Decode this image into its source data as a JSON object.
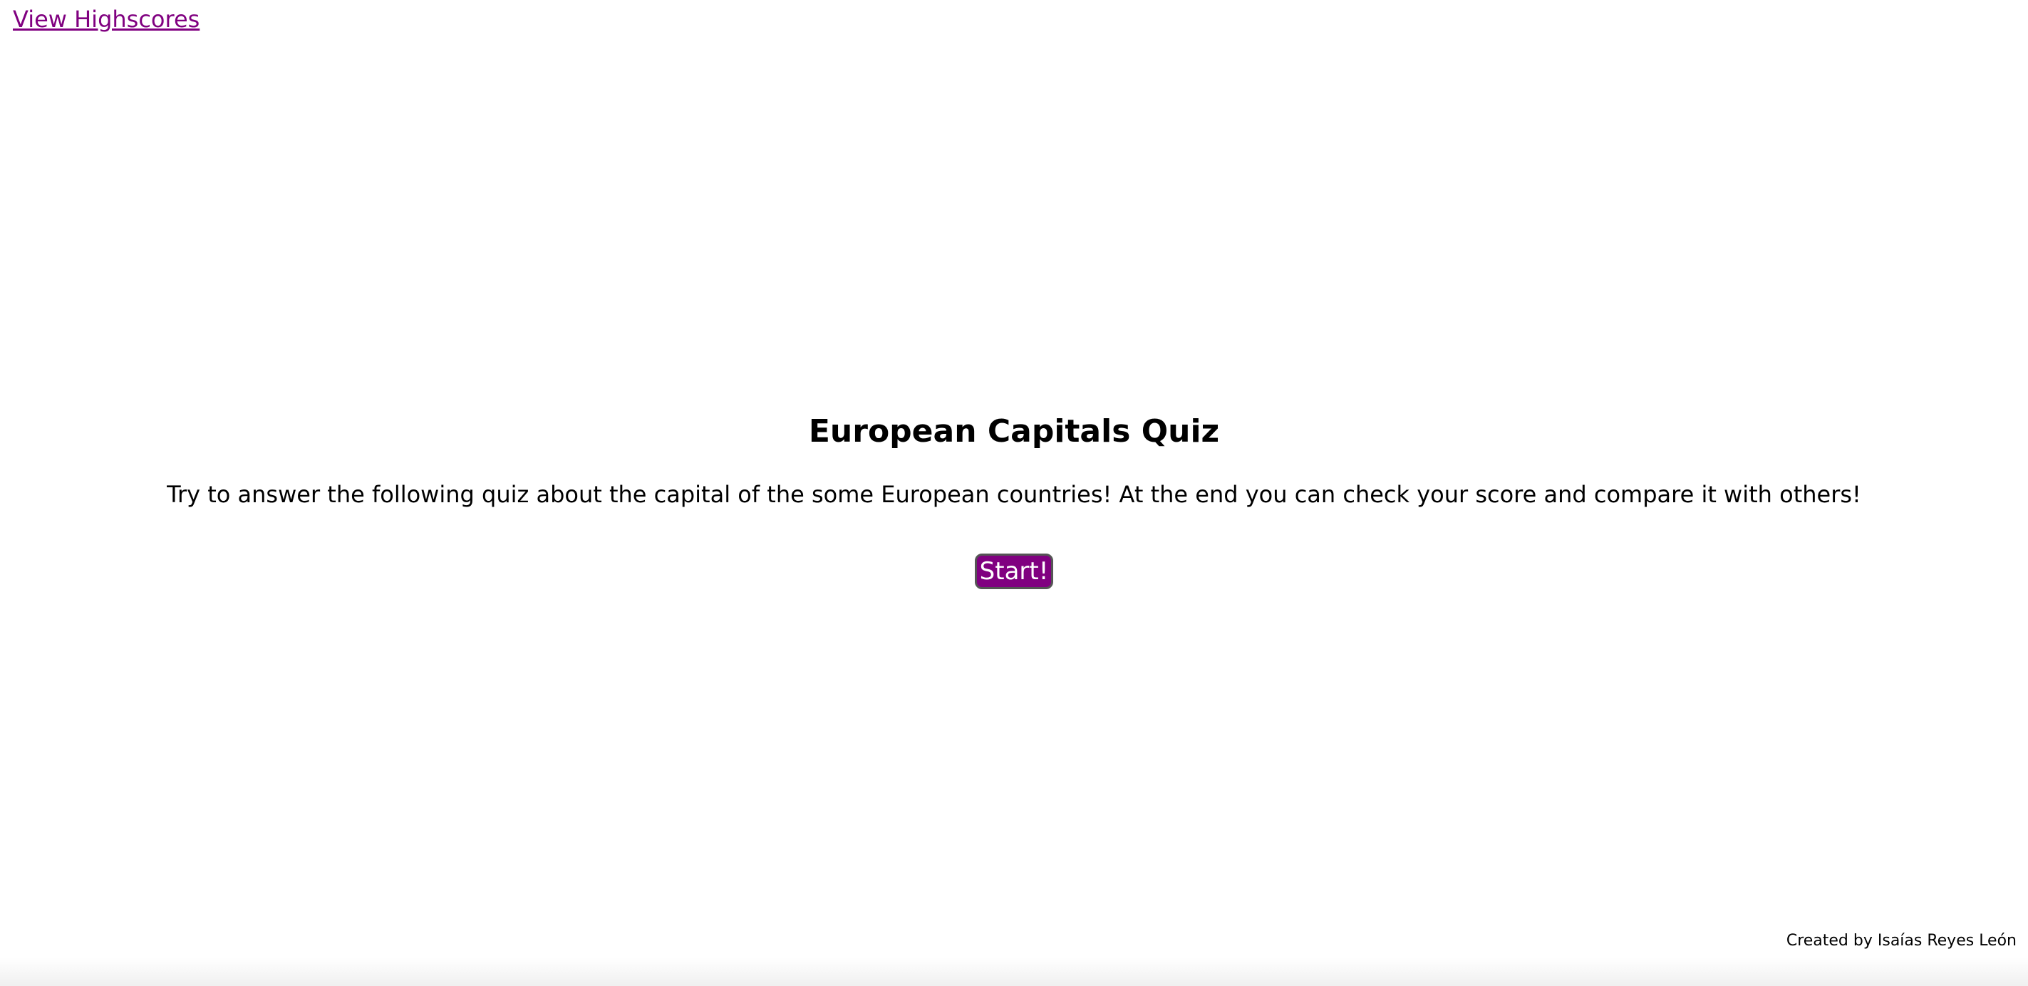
{
  "header": {
    "highscores_link": "View Highscores"
  },
  "main": {
    "title": "European Capitals Quiz",
    "intro": "Try to answer the following quiz about the capital of the some European countries! At the end you can check your score and compare it with others!",
    "start_label": "Start!"
  },
  "footer": {
    "credit": "Created by Isaías Reyes León"
  },
  "colors": {
    "accent": "#800080",
    "button_border": "#555555",
    "background": "#ffffff",
    "text": "#000000"
  }
}
